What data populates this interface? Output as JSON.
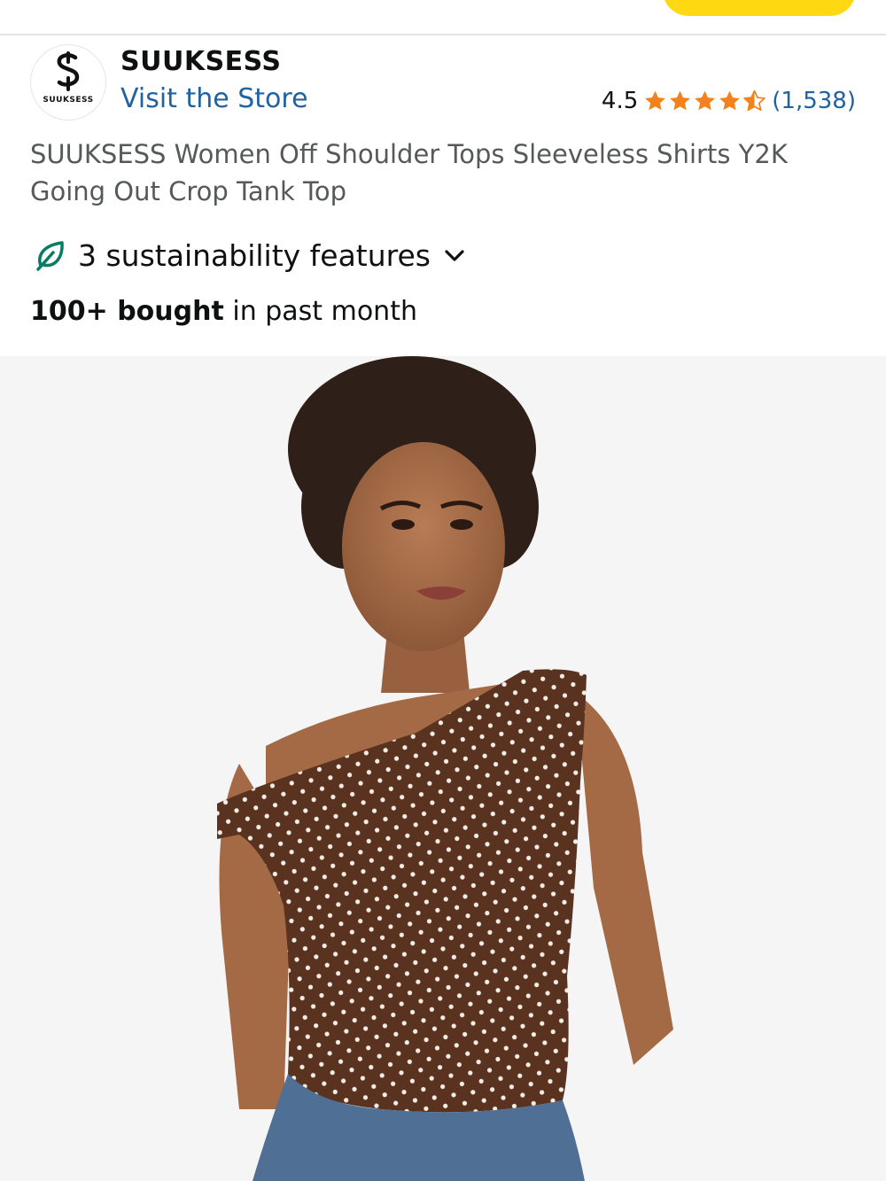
{
  "header": {
    "button_color": "#ffd814"
  },
  "brand": {
    "logo_text": "SUUKSESS",
    "name": "SUUKSESS",
    "visit_store": "Visit the Store"
  },
  "rating": {
    "value": "4.5",
    "stars": 4.5,
    "count": "(1,538)",
    "star_color": "#f3811c"
  },
  "product": {
    "title": "SUUKSESS Women Off Shoulder Tops Sleeveless Shirts Y2K Going Out Crop Tank Top",
    "sustainability": "3 sustainability features",
    "bought_bold": "100+ bought",
    "bought_rest": " in past month"
  },
  "image": {
    "subject": "model-wearing-brown-polka-dot-one-shoulder-top"
  },
  "colors": {
    "link": "#2162a1",
    "text": "#0f1111",
    "muted": "#565959",
    "leaf": "#067d62"
  }
}
